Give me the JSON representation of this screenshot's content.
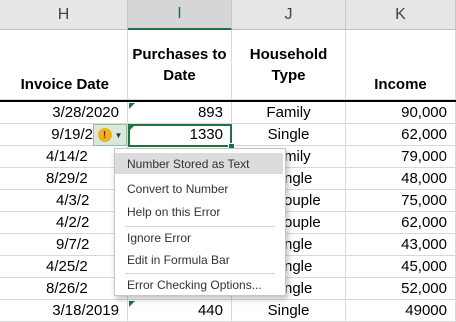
{
  "columns": [
    {
      "letter": "H",
      "header": [
        "Invoice Date"
      ]
    },
    {
      "letter": "I",
      "header": [
        "Purchases to",
        "Date"
      ]
    },
    {
      "letter": "J",
      "header": [
        "Household",
        "Type"
      ]
    },
    {
      "letter": "K",
      "header": [
        "Income"
      ]
    }
  ],
  "rows": [
    {
      "date": "3/28/2020",
      "purchases": "893",
      "type": "Family",
      "income": "90,000"
    },
    {
      "date": "9/19/2",
      "purchases": "1330",
      "type": "Single",
      "income": "62,000"
    },
    {
      "date": "4/14/2",
      "purchases": "",
      "type": "mily",
      "income": "79,000"
    },
    {
      "date": "8/29/2",
      "purchases": "",
      "type": "ngle",
      "income": "48,000"
    },
    {
      "date": "4/3/2",
      "purchases": "",
      "type": "ouple",
      "income": "75,000"
    },
    {
      "date": "4/2/2",
      "purchases": "",
      "type": "ouple",
      "income": "62,000"
    },
    {
      "date": "9/7/2",
      "purchases": "",
      "type": "ngle",
      "income": "43,000"
    },
    {
      "date": "4/25/2",
      "purchases": "",
      "type": "ngle",
      "income": "45,000"
    },
    {
      "date": "8/26/2",
      "purchases": "",
      "type": "ngle",
      "income": "52,000"
    },
    {
      "date": "3/18/2019",
      "purchases": "440",
      "type": "Single",
      "income": "49000"
    }
  ],
  "error_menu": {
    "items": [
      "Number Stored as Text",
      "Convert to Number",
      "Help on this Error",
      "Ignore Error",
      "Edit in Formula Bar",
      "Error Checking Options..."
    ],
    "highlighted_index": 0
  },
  "error_button": {
    "icon": "warning-icon",
    "glyph": "!"
  },
  "colors": {
    "accent": "#217346",
    "warning": "#f2b01e"
  }
}
